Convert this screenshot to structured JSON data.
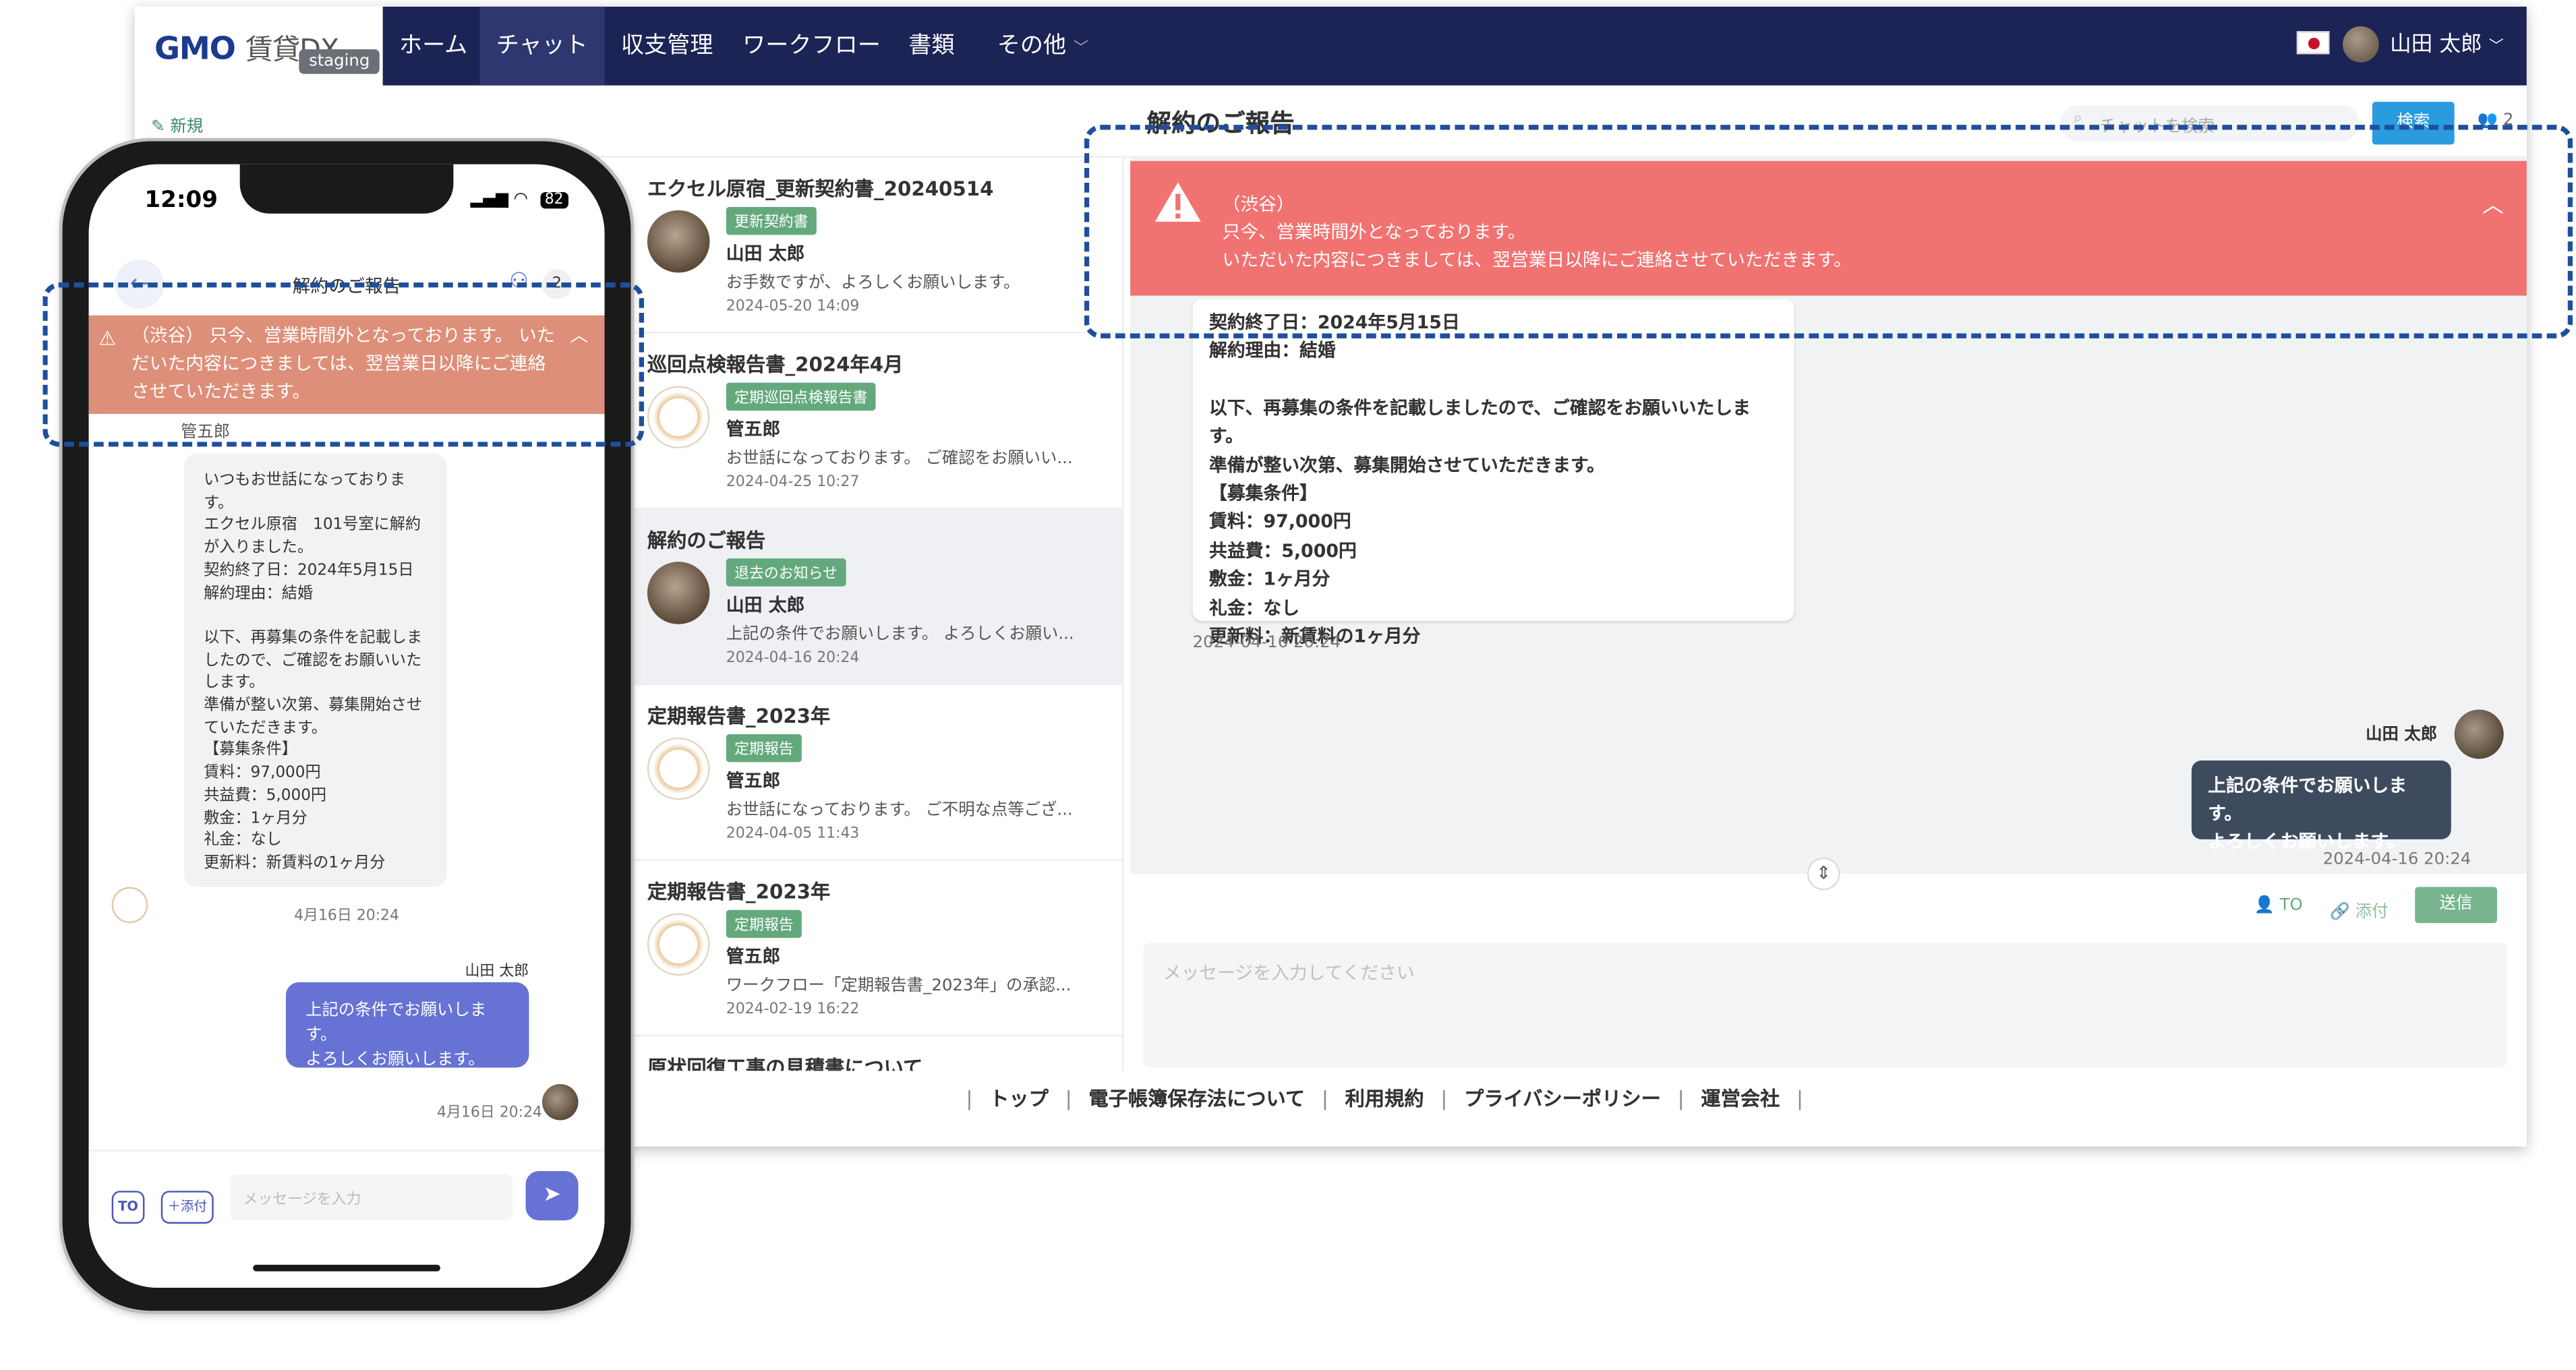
{
  "nav": {
    "logo_main": "GMO",
    "logo_sub": "賃貸DX",
    "env_badge": "staging",
    "items": [
      "ホーム",
      "チャット",
      "収支管理",
      "ワークフロー",
      "書類",
      "その他"
    ],
    "user_name": "山田 太郎"
  },
  "subbar": {
    "new_label": "新規",
    "chat_title": "解約のご報告",
    "search_placeholder": "チャットを検索",
    "search_button": "検索",
    "member_count": "2"
  },
  "chat_list": [
    {
      "title": "エクセル原宿_更新契約書_20240514",
      "tag": "更新契約書",
      "name": "山田 太郎",
      "message": "お手数ですが、よろしくお願いします。",
      "date": "2024-05-20 14:09"
    },
    {
      "title": "巡回点検報告書_2024年4月",
      "tag": "定期巡回点検報告書",
      "name": "管五郎",
      "message": "お世話になっております。 ご確認をお願いい...",
      "date": "2024-04-25 10:27"
    },
    {
      "title": "解約のご報告",
      "tag": "退去のお知らせ",
      "name": "山田 太郎",
      "message": "上記の条件でお願いします。 よろしくお願い...",
      "date": "2024-04-16 20:24"
    },
    {
      "title": "定期報告書_2023年",
      "tag": "定期報告",
      "name": "管五郎",
      "message": "お世話になっております。 ご不明な点等ござ...",
      "date": "2024-04-05 11:43"
    },
    {
      "title": "定期報告書_2023年",
      "tag": "定期報告",
      "name": "管五郎",
      "message": "ワークフロー「定期報告書_2023年」の承認...",
      "date": "2024-02-19 16:22"
    },
    {
      "title": "原状回復工事の見積書について",
      "tag": "",
      "name": "",
      "message": "",
      "date": ""
    }
  ],
  "alert": {
    "line1": "（渋谷）",
    "line2": "只今、営業時間外となっております。",
    "line3": "いただいた内容につきましては、翌営業日以降にご連絡させていただきます。"
  },
  "messages": {
    "incoming_lines": [
      "契約終了日：2024年5月15日",
      "解約理由：結婚",
      "",
      "以下、再募集の条件を記載しましたので、ご確認をお願いいたします。",
      "準備が整い次第、募集開始させていただきます。",
      "【募集条件】",
      "賃料：97,000円",
      "共益費：5,000円",
      "敷金：1ヶ月分",
      "礼金：なし",
      "更新料：新賃料の1ヶ月分"
    ],
    "incoming_date": "2024-04-16 20:24",
    "outgoing_name": "山田 太郎",
    "outgoing_text": "上記の条件でお願いします。\nよろしくお願いします。",
    "outgoing_date": "2024-04-16 20:24"
  },
  "composer": {
    "to_label": "TO",
    "attach_label": "添付",
    "send_label": "送信",
    "placeholder": "メッセージを入力してください"
  },
  "footer": {
    "links": [
      "トップ",
      "電子帳簿保存法について",
      "利用規約",
      "プライバシーポリシー",
      "運営会社"
    ]
  },
  "phone": {
    "time": "12:09",
    "battery": "82",
    "title": "解約のご報告",
    "member_count": "2",
    "alert_text": "（渋谷） 只今、営業時間外となっております。 いただいた内容につきましては、翌営業日以降にご連絡させていただきます。",
    "sender": "管五郎",
    "incoming_text": "いつもお世話になっております。\nエクセル原宿　101号室に解約が入りました。\n契約終了日：2024年5月15日\n解約理由：結婚\n\n以下、再募集の条件を記載しましたので、ご確認をお願いいたします。\n準備が整い次第、募集開始させていただきます。\n【募集条件】\n賃料：97,000円\n共益費：5,000円\n敷金：1ヶ月分\n礼金：なし\n更新料：新賃料の1ヶ月分",
    "incoming_date": "4月16日 20:24",
    "outgoing_name": "山田 太郎",
    "outgoing_text": "上記の条件でお願いします。\nよろしくお願いします。",
    "outgoing_date": "4月16日 20:24",
    "to_label": "TO",
    "attach_label": "＋添付",
    "input_placeholder": "メッセージを入力"
  }
}
